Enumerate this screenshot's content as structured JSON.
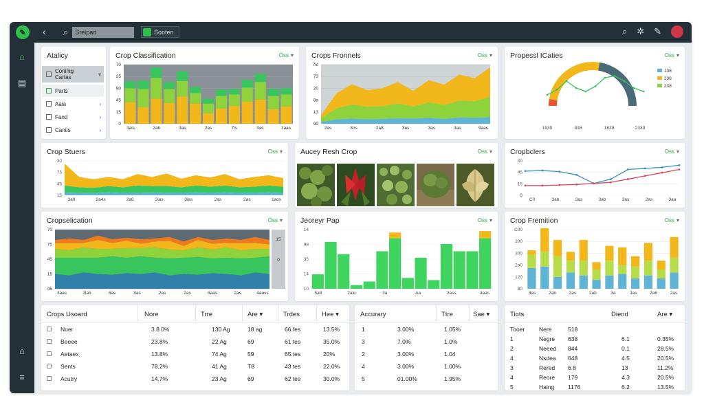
{
  "topbar": {
    "search_placeholder": "Sreipad",
    "search_button": "Sooten",
    "icons": [
      "back-icon",
      "search-icon",
      "settings-icon",
      "pin-icon",
      "avatar"
    ]
  },
  "sidenav": {
    "icons": [
      "home-icon",
      "book-icon",
      "house-icon",
      "menu-icon"
    ]
  },
  "filter_label": "Oss",
  "analytics": {
    "title": "Atalicy",
    "items": [
      {
        "label": "Coninig",
        "sub": "Cartas",
        "arrow": "‹"
      },
      {
        "label": "Parts"
      },
      {
        "label": "Aaia",
        "arrow": "›"
      },
      {
        "label": "Fand",
        "arrow": "›"
      },
      {
        "label": "Cantis",
        "arrow": "›"
      }
    ]
  },
  "crop_classification": {
    "title": "Crop Classification",
    "y_ticks": [
      "70",
      "25",
      "90",
      "45",
      "15",
      "0"
    ],
    "x_ticks": [
      "3ais",
      "2ab",
      "3as",
      "2as",
      "7ls",
      "3as",
      "1aas"
    ],
    "chart_data": {
      "type": "bar",
      "stacked": true,
      "series": [
        {
          "color": "#f2b71b",
          "values": [
            62,
            48,
            72,
            60,
            78,
            58,
            30,
            44,
            52,
            64,
            70,
            42,
            50
          ]
        },
        {
          "color": "#8ed33c",
          "values": [
            40,
            52,
            60,
            40,
            45,
            30,
            28,
            36,
            32,
            40,
            50,
            38,
            34
          ]
        },
        {
          "color": "#39c55e",
          "values": [
            20,
            24,
            30,
            20,
            28,
            18,
            14,
            18,
            16,
            22,
            24,
            20,
            18
          ]
        }
      ]
    }
  },
  "crops_fronnels": {
    "title": "Crops Fronnels",
    "y_ticks": [
      "7ls",
      "73",
      "20",
      "8a",
      "13",
      "90"
    ],
    "x_ticks": [
      "2as",
      "3ns",
      "2a8",
      "3as",
      "3as",
      "3as",
      "9aas"
    ],
    "chart_data": {
      "type": "area",
      "stacked": true,
      "series": [
        {
          "color": "#5fb4d6",
          "values": [
            5,
            12,
            14,
            12,
            13,
            15,
            14,
            16,
            13,
            17,
            16,
            18
          ]
        },
        {
          "color": "#8ed33c",
          "values": [
            10,
            30,
            38,
            34,
            35,
            40,
            33,
            42,
            38,
            46,
            45,
            55
          ]
        },
        {
          "color": "#f2b71b",
          "values": [
            8,
            40,
            55,
            45,
            48,
            58,
            42,
            60,
            55,
            70,
            62,
            80
          ]
        }
      ]
    }
  },
  "progress_cartes": {
    "title": "Propessl ICaties",
    "x_ticks": [
      "1939",
      "838",
      "1839",
      "2339"
    ],
    "legend": [
      {
        "label": "138",
        "color": "#5fb4d6"
      },
      {
        "label": "238",
        "color": "#f2b71b"
      },
      {
        "label": "238",
        "color": "#8ed33c"
      }
    ],
    "chart_data": {
      "type": "line",
      "gauge_fill": 0.7,
      "series": [
        {
          "color": "#39c55e",
          "values": [
            20,
            35,
            60,
            40,
            30,
            45,
            70,
            75,
            60,
            40,
            30
          ]
        }
      ]
    }
  },
  "crop_stouers": {
    "title": "Crop Stuers",
    "y_ticks": [
      "30",
      "75",
      "45",
      "15"
    ],
    "x_ticks": [
      "3a9",
      "2a4s",
      "2a8",
      "3ias",
      "3ias",
      "2as",
      "2as",
      "1aos"
    ],
    "chart_data": {
      "type": "area",
      "stacked": true,
      "series": [
        {
          "color": "#5fb4d6",
          "values": [
            5,
            4,
            4,
            5,
            4,
            4,
            5,
            4,
            4,
            5,
            4,
            5,
            4,
            4,
            5,
            4
          ]
        },
        {
          "color": "#39c55e",
          "values": [
            12,
            10,
            9,
            11,
            10,
            13,
            11,
            12,
            10,
            12,
            11,
            12,
            10,
            11,
            12,
            11
          ]
        },
        {
          "color": "#f2b71b",
          "values": [
            38,
            18,
            15,
            16,
            14,
            20,
            16,
            22,
            15,
            18,
            16,
            20,
            14,
            17,
            18,
            15
          ]
        }
      ]
    }
  },
  "aucey_resh_crop": {
    "title": "Aucey Resh Crop",
    "photos": [
      "leafy-plant-photo",
      "red-flower-photo",
      "herb-photo",
      "shrub-photo",
      "yellow-leaf-photo"
    ]
  },
  "crop_bclers": {
    "title": "Cropbclers",
    "y_ticks": [
      "30",
      "45",
      "15",
      "8"
    ],
    "x_ticks": [
      "C0",
      "3ab",
      "3as",
      "3ab",
      "3as",
      "2as",
      "3aa"
    ],
    "chart_data": {
      "type": "line",
      "series": [
        {
          "color": "#3a8fc2",
          "values": [
            45,
            46,
            44,
            38,
            22,
            30,
            48,
            50,
            52,
            56
          ]
        },
        {
          "color": "#d9445a",
          "values": [
            18,
            18,
            19,
            20,
            22,
            24,
            30,
            36,
            42,
            48
          ]
        }
      ]
    }
  },
  "crop_selication": {
    "title": "Cropselication",
    "y_ticks": [
      "70",
      "75",
      "45",
      "15",
      "45",
      "15",
      "0"
    ],
    "x_ticks": [
      "3aas",
      "2lab",
      "3as",
      "3as",
      "2as",
      "2as",
      "3aas",
      "2as",
      "4aass"
    ],
    "chart_data": {
      "type": "area",
      "stacked": true,
      "series": [
        {
          "color": "#2f7fa8",
          "values": [
            20,
            18,
            22,
            20,
            19,
            21,
            20,
            22,
            18,
            20,
            19,
            21,
            20,
            18,
            22,
            20
          ]
        },
        {
          "color": "#39c55e",
          "values": [
            22,
            24,
            20,
            22,
            25,
            21,
            24,
            20,
            23,
            22,
            24,
            20,
            22,
            23,
            20,
            24
          ]
        },
        {
          "color": "#8ed33c",
          "values": [
            12,
            10,
            14,
            12,
            10,
            13,
            11,
            14,
            12,
            10,
            13,
            12,
            14,
            11,
            12,
            10
          ]
        },
        {
          "color": "#f2b71b",
          "values": [
            8,
            10,
            6,
            12,
            8,
            10,
            6,
            8,
            12,
            6,
            10,
            8,
            6,
            10,
            8,
            6
          ]
        },
        {
          "color": "#ef7a1e",
          "values": [
            4,
            6,
            4,
            6,
            5,
            4,
            6,
            4,
            5,
            6,
            4,
            5,
            6,
            4,
            8,
            6
          ]
        }
      ]
    }
  },
  "jeoreyr_pap": {
    "title": "Jeoreyr Pap",
    "y_ticks": [
      "14",
      "98",
      "35",
      "14",
      "10"
    ],
    "x_ticks": [
      "5a8",
      "2ale",
      "3a",
      "Aa",
      "2ass",
      "4aas"
    ],
    "chart_data": {
      "type": "bar",
      "series": [
        {
          "color": "#3ed45f",
          "values": [
            20,
            65,
            48,
            5,
            10,
            52,
            70,
            15,
            43,
            12,
            62,
            52,
            52,
            70
          ]
        },
        {
          "color": "#f2b71b",
          "values": [
            0,
            0,
            0,
            0,
            0,
            0,
            8,
            0,
            0,
            0,
            0,
            0,
            0,
            10
          ]
        }
      ]
    }
  },
  "crop_fremition": {
    "title": "Crop Fremition",
    "y_ticks": [
      "C00",
      "200",
      "300",
      "2a0",
      "120",
      "80",
      "0"
    ],
    "x_ticks": [
      "3as",
      "2ab",
      "3as",
      "2ab",
      "3a",
      "3as",
      "2a6",
      "2as"
    ],
    "chart_data": {
      "type": "bar",
      "stacked": true,
      "series": [
        {
          "color": "#5fb4d6",
          "values": [
            28,
            30,
            16,
            22,
            18,
            12,
            18,
            20,
            14,
            18,
            14,
            22
          ]
        },
        {
          "color": "#b6dc4a",
          "values": [
            18,
            20,
            28,
            16,
            20,
            14,
            20,
            12,
            16,
            20,
            12,
            20
          ]
        },
        {
          "color": "#f2b71b",
          "values": [
            6,
            32,
            22,
            12,
            28,
            10,
            20,
            24,
            14,
            24,
            12,
            28
          ]
        }
      ]
    }
  },
  "crops_board": {
    "title": "Crops Usoard",
    "columns": [
      "Nore",
      "Trre",
      "Are",
      "Trdes",
      "Hee"
    ],
    "rows": [
      [
        "Nuer",
        "3.8 0%",
        "130 Ag",
        "18 ag",
        "66.fes",
        "13.5%"
      ],
      [
        "Beeee",
        "23.8%",
        "22 Ag",
        "69",
        "61 tes",
        "35.0%"
      ],
      [
        "Aetaex",
        "13.8%",
        "74 Ag",
        "59",
        "65.tes",
        "20%"
      ],
      [
        "Sents",
        "78.2%",
        "41 Ag",
        "T8",
        "43 tes",
        "22.0%"
      ],
      [
        "Acutry",
        "14.7%",
        "23 Ag",
        "69",
        "62 tes",
        "30.0%"
      ]
    ]
  },
  "accuracy": {
    "title": "Accurary",
    "columns": [
      "Ttre",
      "Sae"
    ],
    "rows": [
      [
        "1",
        "3.00%",
        "1.05%"
      ],
      [
        "3",
        "7.0%",
        "1.0%"
      ],
      [
        "2",
        "3.00%",
        "1.04"
      ],
      [
        "4",
        "3.00%",
        "1.00%"
      ],
      [
        "5",
        "01.00%",
        "1.95%"
      ]
    ]
  },
  "totals": {
    "title": "Tiots",
    "columns": [
      "Tooer",
      "Nere",
      "518",
      "Diend",
      "Are"
    ],
    "rows": [
      [
        "1",
        "Negre",
        "638",
        "6.1",
        "0.35%"
      ],
      [
        "2",
        "Neeed",
        "844",
        "0.1",
        "28.5%"
      ],
      [
        "4",
        "Nsdea",
        "648",
        "4.5",
        "20.5%"
      ],
      [
        "3",
        "Rered",
        "6.8",
        "13",
        "11.2%"
      ],
      [
        "4",
        "Reore",
        "179",
        "4.3",
        "20.5%"
      ],
      [
        "5",
        "Haing",
        "1176",
        "6.2",
        "13.5%"
      ]
    ]
  }
}
